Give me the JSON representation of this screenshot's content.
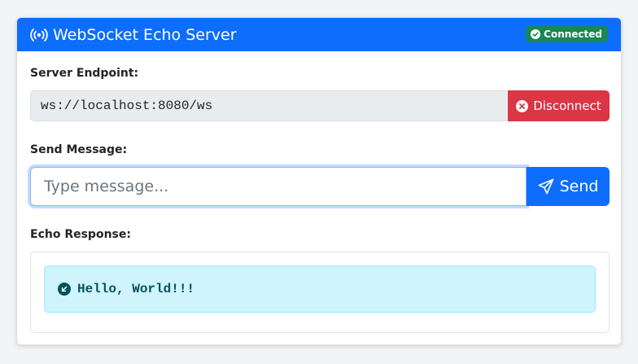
{
  "header": {
    "title": "WebSocket Echo Server",
    "icon": "broadcast-icon",
    "status_badge": "Connected",
    "status_icon": "check-circle-icon"
  },
  "endpoint": {
    "label": "Server Endpoint:",
    "value": "ws://localhost:8080/ws",
    "disconnect_label": "Disconnect",
    "disconnect_icon": "x-circle-icon"
  },
  "send": {
    "label": "Send Message:",
    "placeholder": "Type message...",
    "value": "",
    "button_label": "Send",
    "button_icon": "send-icon"
  },
  "response": {
    "label": "Echo Response:",
    "message": "Hello, World!!!",
    "message_icon": "arrow-down-left-circle-icon"
  },
  "colors": {
    "primary": "#0d6efd",
    "danger": "#dc3545",
    "success": "#198754",
    "info_bg": "#cff4fc",
    "info_text": "#055160"
  }
}
